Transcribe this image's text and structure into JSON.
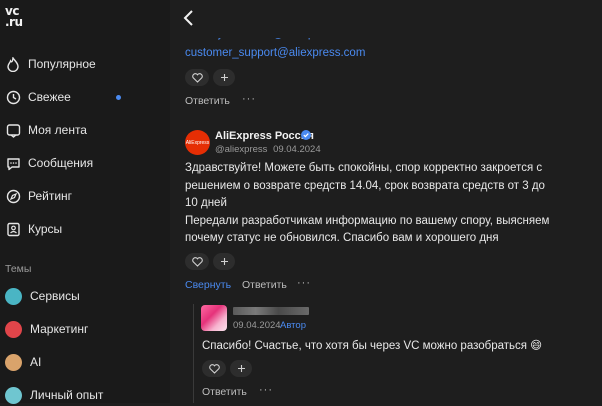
{
  "logo": {
    "line1": "vc",
    "line2": ".ru"
  },
  "sidebar": {
    "nav": [
      {
        "label": "Популярное",
        "icon": "fire-icon"
      },
      {
        "label": "Свежее",
        "icon": "clock-icon"
      },
      {
        "label": "Моя лента",
        "icon": "feed-icon"
      },
      {
        "label": "Сообщения",
        "icon": "chat-icon"
      },
      {
        "label": "Рейтинг",
        "icon": "compass-icon"
      },
      {
        "label": "Курсы",
        "icon": "courses-icon"
      }
    ],
    "themes_header": "Темы",
    "themes": [
      {
        "label": "Сервисы",
        "color": "#4ab5c4"
      },
      {
        "label": "Маркетинг",
        "color": "#e0454a"
      },
      {
        "label": "AI",
        "color": "#d9a36b"
      },
      {
        "label": "Личный опыт",
        "color": "#6fc6d0"
      }
    ],
    "unread_color": "#4a8af0"
  },
  "feed": {
    "partial_link": "RU.buyer.service@aliexpress.com",
    "link": "customer_support@aliexpress.com",
    "reply_label_1": "Ответить",
    "comment": {
      "author": "AliExpress Россия",
      "avatar_text": "AliExpress",
      "handle": "@aliexpress",
      "date": "09.04.2024",
      "text_1": "Здравствуйте! Можете быть спокойны, спор корректно закроется с решением о возврате средств 14.04, срок возврата средств от 3 до 10 дней",
      "text_2": "Передали разработчикам информацию по вашему спору, выясняем почему статус не обновился. Спасибо вам и хорошего дня",
      "collapse_label": "Свернуть",
      "reply_label": "Ответить"
    },
    "reply": {
      "date": "09.04.2024",
      "badge": "Автор",
      "text": "Спасибо! Счастье, что хотя бы через VC можно разобраться 😄",
      "reply_label": "Ответить"
    }
  }
}
